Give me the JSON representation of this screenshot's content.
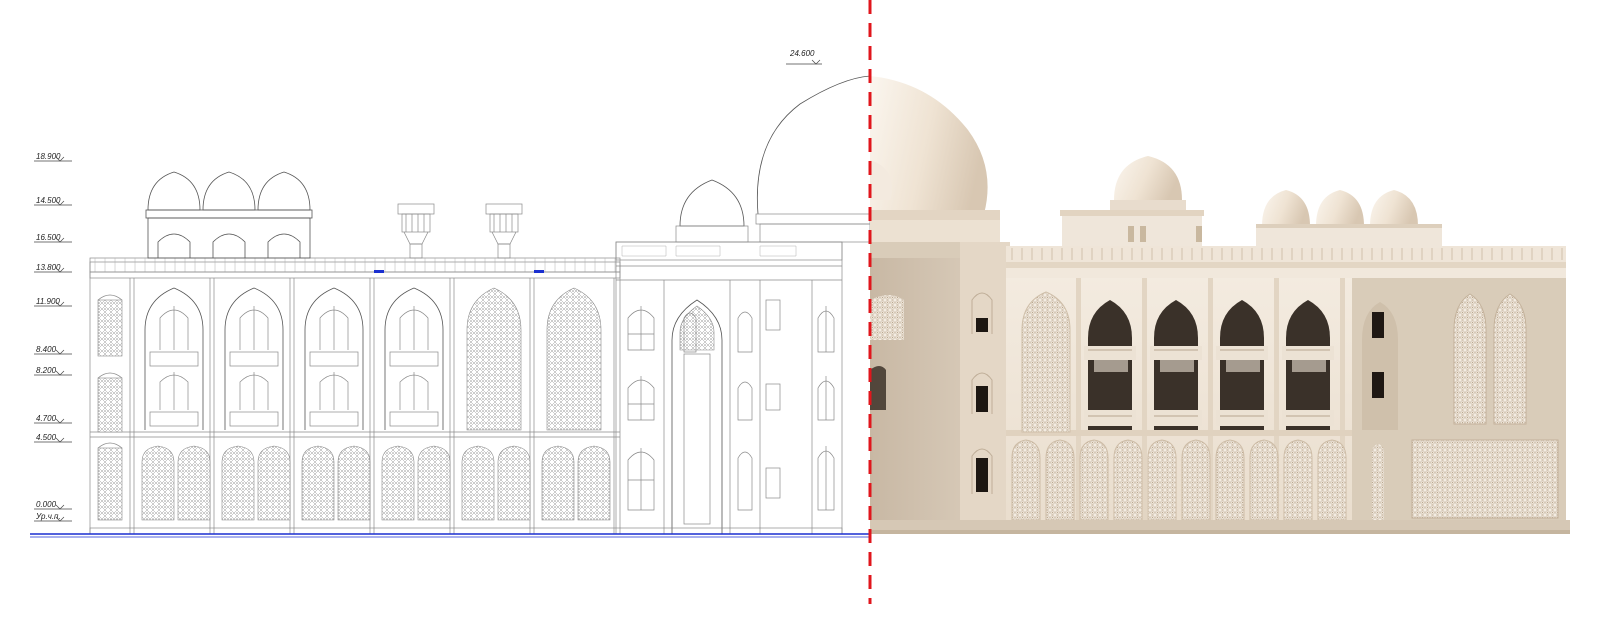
{
  "drawing": {
    "levels": [
      {
        "label": "18.900"
      },
      {
        "label": "14.500"
      },
      {
        "label": "16.500"
      },
      {
        "label": "13.800"
      },
      {
        "label": "11.900"
      },
      {
        "label": "8.400"
      },
      {
        "label": "8.200"
      },
      {
        "label": "4.700"
      },
      {
        "label": "4.500"
      },
      {
        "label": "0.000"
      },
      {
        "label": "Ур.ч.п."
      }
    ],
    "top_level": {
      "label": "24.600"
    }
  },
  "colors": {
    "divider": "#e0161c",
    "ground_line": "#1a2fd0",
    "render_stone": "#efe5d8",
    "render_shadow": "#cdbfae",
    "line_work": "#8a8a8a"
  }
}
